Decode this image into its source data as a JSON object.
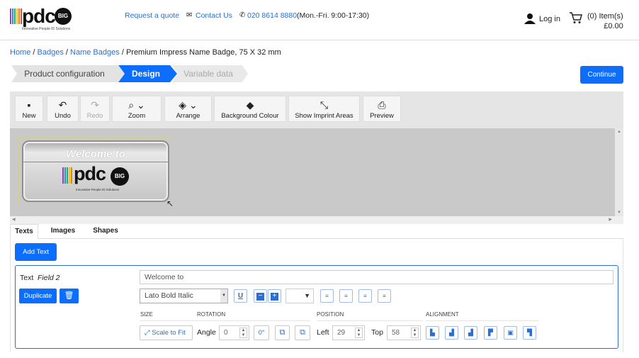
{
  "header": {
    "logo_text": "pdc",
    "logo_big": "BIG",
    "logo_sub": "Innovative People ID Solutions",
    "request_quote": "Request a quote",
    "contact_us": "Contact Us",
    "phone": "020 8614 8880",
    "hours": "(Mon.-Fri. 9:00-17:30)",
    "login": "Log in",
    "cart_items": "(0) Item(s)",
    "cart_total": "£0.00"
  },
  "breadcrumb": {
    "home": "Home",
    "badges": "Badges",
    "name_badges": "Name Badges",
    "current": "Premium Impress Name Badge, 75 X 32 mm",
    "separator": "/"
  },
  "steps": [
    {
      "label": "Product configuration",
      "state": "done"
    },
    {
      "label": "Design",
      "state": "active"
    },
    {
      "label": "Variable data",
      "state": "todo"
    }
  ],
  "continue_label": "Continue",
  "toolbar": {
    "new": "New",
    "undo": "Undo",
    "redo": "Redo",
    "zoom": "Zoom",
    "arrange": "Arrange",
    "background": "Background Colour",
    "imprint": "Show Imprint Areas",
    "preview": "Preview"
  },
  "badge": {
    "welcome": "Welcome to",
    "logo_text": "pdc",
    "logo_big": "BIG",
    "logo_sub": "Innovative People ID Solutions"
  },
  "tabs": [
    "Texts",
    "Images",
    "Shapes"
  ],
  "add_text": "Add Text",
  "field": {
    "label": "Text",
    "name": "Field 2",
    "duplicate": "Duplicate",
    "value": "Welcome to",
    "font": "Lato Bold Italic"
  },
  "sections": {
    "size": "Size",
    "rotation": "Rotation",
    "position": "Position",
    "alignment": "Alignment"
  },
  "controls": {
    "scale_to_fit": "Scale to Fit",
    "angle_label": "Angle",
    "angle_value": "0",
    "zero_degrees": "0°",
    "left_label": "Left",
    "left_value": "29",
    "top_label": "Top",
    "top_value": "58"
  },
  "colors": {
    "accent": "#0d6efd",
    "link": "#2a6fd1",
    "step_active": "#0d6efd",
    "step_inactive": "#e3e3e3",
    "canvas_bg": "#c9c9c9"
  },
  "icons": {
    "user": "user-icon",
    "cart": "cart-icon",
    "envelope": "envelope-icon",
    "phone": "phone-icon",
    "new": "new-document-icon",
    "undo": "undo-icon",
    "redo": "redo-icon",
    "zoom": "magnifier-icon",
    "arrange": "layers-icon",
    "background": "paint-bucket-icon",
    "imprint": "compress-icon",
    "preview": "printer-icon",
    "delete": "trash-icon",
    "underline": "underline-icon",
    "decrease": "minus-icon",
    "increase": "plus-icon"
  }
}
